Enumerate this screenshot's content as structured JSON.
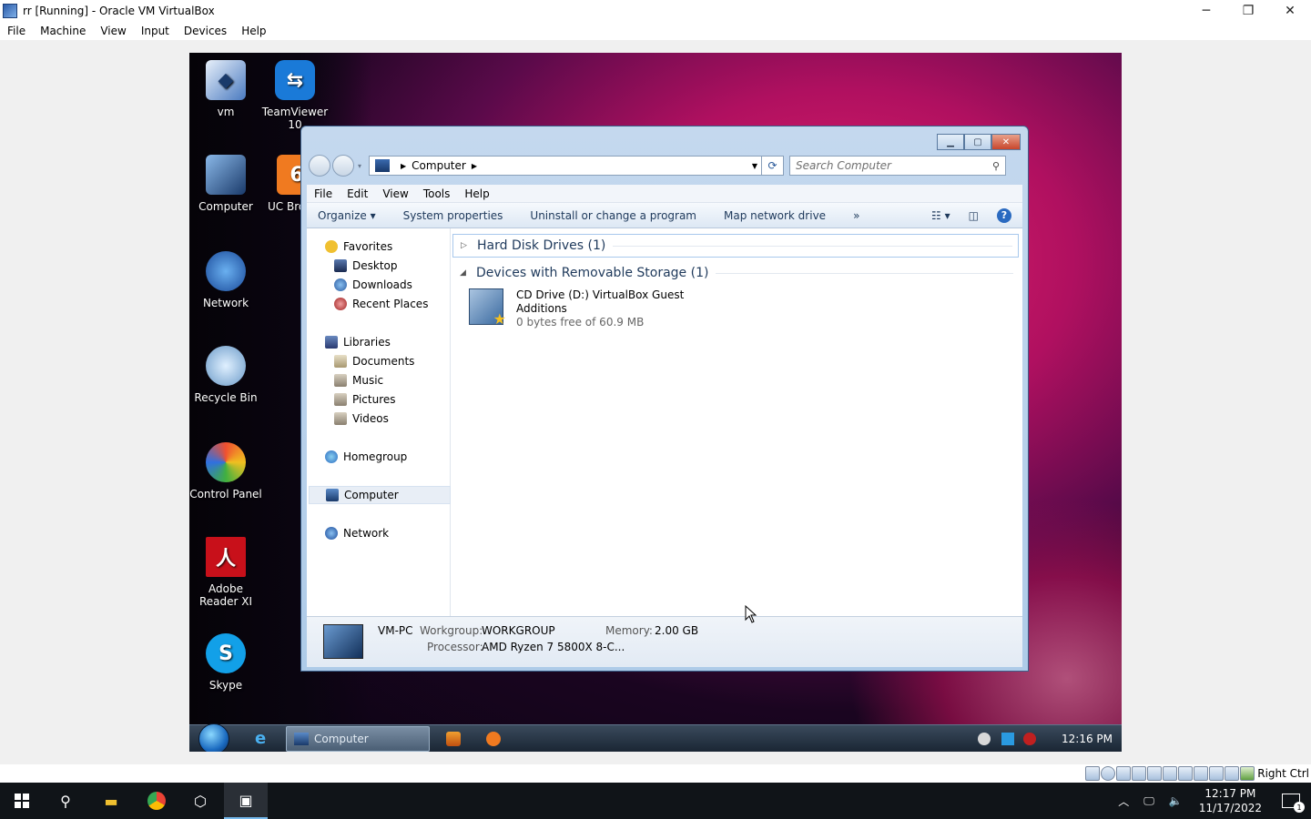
{
  "host": {
    "title": "rr [Running] - Oracle VM VirtualBox",
    "menu": [
      "File",
      "Machine",
      "View",
      "Input",
      "Devices",
      "Help"
    ],
    "window_controls": {
      "minimize": "─",
      "restore": "❐",
      "close": "✕"
    },
    "status_right": "Right Ctrl"
  },
  "desktop_icons": [
    {
      "label": "vm"
    },
    {
      "label": "TeamViewer 10"
    },
    {
      "label": "Computer"
    },
    {
      "label": "UC Bro"
    },
    {
      "label": "Network"
    },
    {
      "label": "Recycle Bin"
    },
    {
      "label": "Control Panel"
    },
    {
      "label": "Adobe Reader XI"
    },
    {
      "label": "Skype"
    }
  ],
  "explorer": {
    "address": "Computer",
    "search_placeholder": "Search Computer",
    "menu": [
      "File",
      "Edit",
      "View",
      "Tools",
      "Help"
    ],
    "commands": [
      "Organize ▾",
      "System properties",
      "Uninstall or change a program",
      "Map network drive",
      "»"
    ],
    "nav": {
      "favorites": "Favorites",
      "desktop": "Desktop",
      "downloads": "Downloads",
      "recent": "Recent Places",
      "libraries": "Libraries",
      "documents": "Documents",
      "music": "Music",
      "pictures": "Pictures",
      "videos": "Videos",
      "homegroup": "Homegroup",
      "computer": "Computer",
      "network": "Network"
    },
    "groups": {
      "hdd": "Hard Disk Drives (1)",
      "removable": "Devices with Removable Storage (1)"
    },
    "drive": {
      "name_line1": "CD Drive (D:) VirtualBox Guest",
      "name_line2": "Additions",
      "space": "0 bytes free of 60.9 MB"
    },
    "details": {
      "pc_name": "VM-PC",
      "workgroup_label": "Workgroup:",
      "workgroup": "WORKGROUP",
      "memory_label": "Memory:",
      "memory": "2.00 GB",
      "processor_label": "Processor:",
      "processor": "AMD Ryzen 7 5800X 8-C..."
    }
  },
  "guest_taskbar": {
    "task_label": "Computer",
    "clock": "12:16 PM"
  },
  "w10_taskbar": {
    "time": "12:17 PM",
    "date": "11/17/2022",
    "notification_count": "1"
  }
}
